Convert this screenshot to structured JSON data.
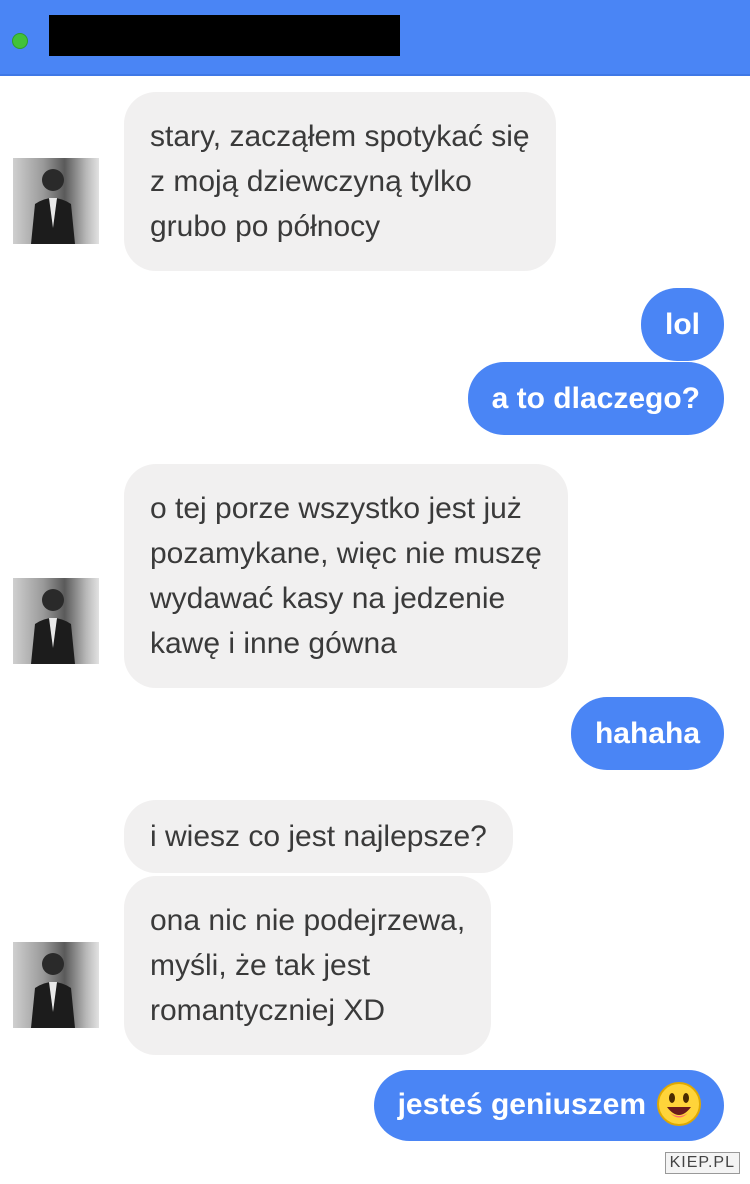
{
  "header": {
    "status_color": "#42c23a",
    "accent": "#4a85f5"
  },
  "messages": {
    "m1": [
      "stary, zacząłem spotykać się",
      "z moją dziewczyną tylko",
      "grubo po północy"
    ],
    "m2": "lol",
    "m3": "a to dlaczego?",
    "m4": [
      "o tej porze wszystko jest już",
      "pozamykane, więc nie muszę",
      "wydawać kasy na jedzenie",
      "kawę i inne gówna"
    ],
    "m5": "hahaha",
    "m6": "i wiesz co jest najlepsze?",
    "m7": [
      "ona nic nie podejrzewa,",
      "myśli, że tak jest",
      "romantyczniej XD"
    ],
    "m8": "jesteś geniuszem"
  },
  "icons": {
    "emoji": "grinning-face-icon",
    "avatar": "contact-avatar"
  },
  "watermark": "KIEP.PL"
}
